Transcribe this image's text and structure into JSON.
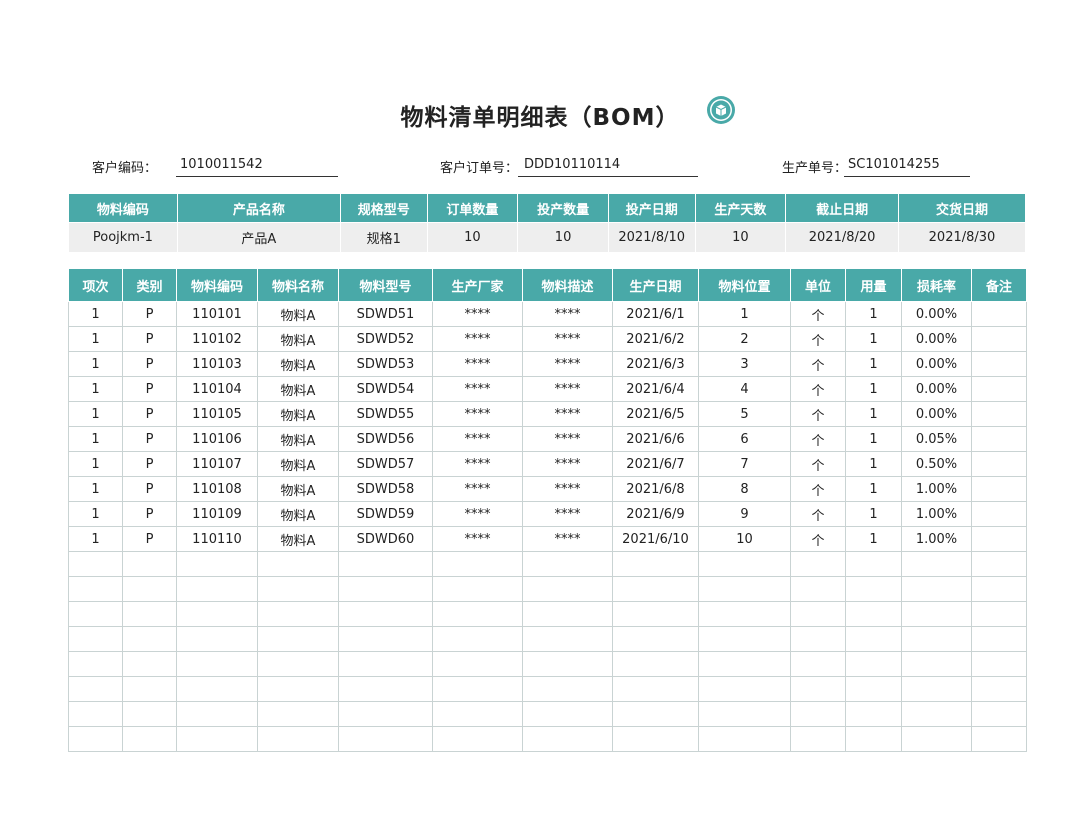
{
  "title": "物料清单明细表（BOM）",
  "logo_icon": "box-icon",
  "accent_color": "#49a9a8",
  "info": {
    "customer_code_label": "客户编码：",
    "customer_code": "1010011542",
    "order_no_label": "客户订单号：",
    "order_no": "DDD10110114",
    "production_no_label": "生产单号：",
    "production_no": "SC101014255"
  },
  "order_table": {
    "headers": [
      "物料编码",
      "产品名称",
      "规格型号",
      "订单数量",
      "投产数量",
      "投产日期",
      "生产天数",
      "截止日期",
      "交货日期"
    ],
    "row": [
      "Poojkm-1",
      "产品A",
      "规格1",
      "10",
      "10",
      "2021/8/10",
      "10",
      "2021/8/20",
      "2021/8/30"
    ]
  },
  "material_table": {
    "headers": [
      "项次",
      "类别",
      "物料编码",
      "物料名称",
      "物料型号",
      "生产厂家",
      "物料描述",
      "生产日期",
      "物料位置",
      "单位",
      "用量",
      "损耗率",
      "备注"
    ],
    "rows": [
      [
        "1",
        "P",
        "110101",
        "物料A",
        "SDWD51",
        "****",
        "****",
        "2021/6/1",
        "1",
        "个",
        "1",
        "0.00%",
        ""
      ],
      [
        "1",
        "P",
        "110102",
        "物料A",
        "SDWD52",
        "****",
        "****",
        "2021/6/2",
        "2",
        "个",
        "1",
        "0.00%",
        ""
      ],
      [
        "1",
        "P",
        "110103",
        "物料A",
        "SDWD53",
        "****",
        "****",
        "2021/6/3",
        "3",
        "个",
        "1",
        "0.00%",
        ""
      ],
      [
        "1",
        "P",
        "110104",
        "物料A",
        "SDWD54",
        "****",
        "****",
        "2021/6/4",
        "4",
        "个",
        "1",
        "0.00%",
        ""
      ],
      [
        "1",
        "P",
        "110105",
        "物料A",
        "SDWD55",
        "****",
        "****",
        "2021/6/5",
        "5",
        "个",
        "1",
        "0.00%",
        ""
      ],
      [
        "1",
        "P",
        "110106",
        "物料A",
        "SDWD56",
        "****",
        "****",
        "2021/6/6",
        "6",
        "个",
        "1",
        "0.05%",
        ""
      ],
      [
        "1",
        "P",
        "110107",
        "物料A",
        "SDWD57",
        "****",
        "****",
        "2021/6/7",
        "7",
        "个",
        "1",
        "0.50%",
        ""
      ],
      [
        "1",
        "P",
        "110108",
        "物料A",
        "SDWD58",
        "****",
        "****",
        "2021/6/8",
        "8",
        "个",
        "1",
        "1.00%",
        ""
      ],
      [
        "1",
        "P",
        "110109",
        "物料A",
        "SDWD59",
        "****",
        "****",
        "2021/6/9",
        "9",
        "个",
        "1",
        "1.00%",
        ""
      ],
      [
        "1",
        "P",
        "110110",
        "物料A",
        "SDWD60",
        "****",
        "****",
        "2021/6/10",
        "10",
        "个",
        "1",
        "1.00%",
        ""
      ],
      [
        "",
        "",
        "",
        "",
        "",
        "",
        "",
        "",
        "",
        "",
        "",
        "",
        ""
      ],
      [
        "",
        "",
        "",
        "",
        "",
        "",
        "",
        "",
        "",
        "",
        "",
        "",
        ""
      ],
      [
        "",
        "",
        "",
        "",
        "",
        "",
        "",
        "",
        "",
        "",
        "",
        "",
        ""
      ],
      [
        "",
        "",
        "",
        "",
        "",
        "",
        "",
        "",
        "",
        "",
        "",
        "",
        ""
      ],
      [
        "",
        "",
        "",
        "",
        "",
        "",
        "",
        "",
        "",
        "",
        "",
        "",
        ""
      ],
      [
        "",
        "",
        "",
        "",
        "",
        "",
        "",
        "",
        "",
        "",
        "",
        "",
        ""
      ],
      [
        "",
        "",
        "",
        "",
        "",
        "",
        "",
        "",
        "",
        "",
        "",
        "",
        ""
      ],
      [
        "",
        "",
        "",
        "",
        "",
        "",
        "",
        "",
        "",
        "",
        "",
        "",
        ""
      ]
    ]
  }
}
